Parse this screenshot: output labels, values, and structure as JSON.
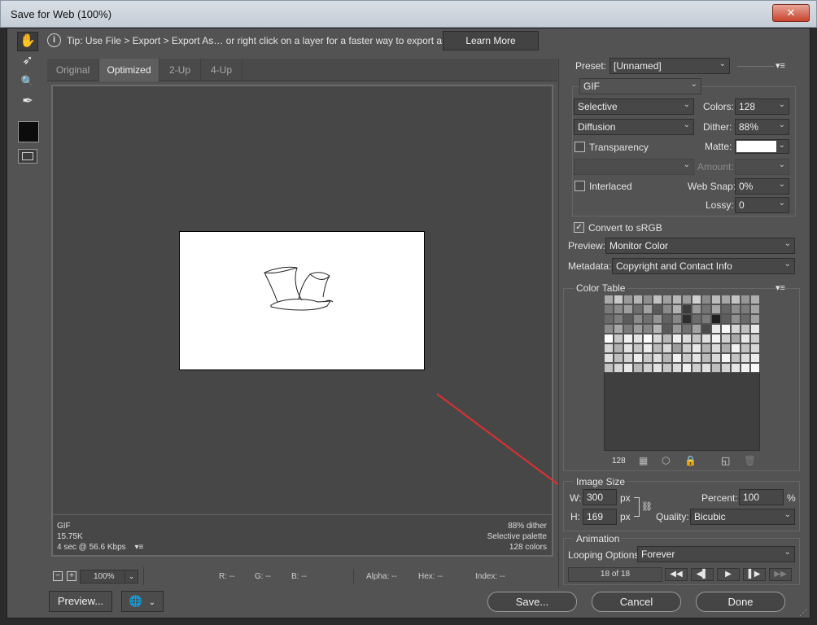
{
  "window": {
    "title": "Save for Web (100%)",
    "close_label": "✕"
  },
  "tools": [
    {
      "name": "hand-tool-icon",
      "glyph": "✋"
    },
    {
      "name": "slice-select-tool-icon",
      "glyph": "➶"
    },
    {
      "name": "zoom-tool-icon",
      "glyph": "🔍"
    },
    {
      "name": "eyedropper-tool-icon",
      "glyph": "✒"
    }
  ],
  "tip": {
    "info_glyph": "i",
    "text": "Tip: Use File > Export > Export As…   or right click on a layer for a faster way to export assets",
    "learn_more": "Learn More"
  },
  "tabs": [
    "Original",
    "Optimized",
    "2-Up",
    "4-Up"
  ],
  "image_info": {
    "format": "GIF",
    "size": "15.75K",
    "download": "4 sec @ 56.6 Kbps",
    "menu_glyph": "▾≡",
    "dither": "88% dither",
    "palette": "Selective palette",
    "colors": "128 colors"
  },
  "status": {
    "zoom": "100%",
    "r": "R: --",
    "g": "G: --",
    "b": "B: --",
    "alpha": "Alpha: --",
    "hex": "Hex: --",
    "index": "Index: --"
  },
  "bottom_buttons": {
    "preview": "Preview...",
    "browser_glyph": "🌐",
    "save": "Save...",
    "cancel": "Cancel",
    "done": "Done"
  },
  "settings": {
    "preset_label": "Preset:",
    "preset_value": "[Unnamed]",
    "format": "GIF",
    "reduction": "Selective",
    "colors_label": "Colors:",
    "colors_value": "128",
    "dither_algo": "Diffusion",
    "dither_label": "Dither:",
    "dither_value": "88%",
    "transparency": "Transparency",
    "matte_label": "Matte:",
    "amount_label": "Amount:",
    "interlaced": "Interlaced",
    "websnap_label": "Web Snap:",
    "websnap_value": "0%",
    "lossy_label": "Lossy:",
    "lossy_value": "0",
    "convert_srgb": "Convert to sRGB",
    "preview_label": "Preview:",
    "preview_value": "Monitor Color",
    "metadata_label": "Metadata:",
    "metadata_value": "Copyright and Contact Info"
  },
  "color_table": {
    "title": "Color Table",
    "count": "128",
    "swatches": [
      "#aaaaaa",
      "#c8c8c8",
      "#9a9a9a",
      "#b5b5b5",
      "#8e8e8e",
      "#c0c0c0",
      "#a0a0a0",
      "#b8b8b8",
      "#9c9c9c",
      "#d0d0d0",
      "#8a8a8a",
      "#bcbcbc",
      "#a6a6a6",
      "#c4c4c4",
      "#969696",
      "#b0b0b0",
      "#7a7a7a",
      "#8c8c8c",
      "#9e9e9e",
      "#6e6e6e",
      "#a2a2a2",
      "#5a5a5a",
      "#8a8a8a",
      "#b2b2b2",
      "#3c3c3c",
      "#9a9a9a",
      "#747474",
      "#a8a8a8",
      "#666666",
      "#8e8e8e",
      "#7c7c7c",
      "#a4a4a4",
      "#6a6a6a",
      "#7e7e7e",
      "#5c5c5c",
      "#8a8a8a",
      "#707070",
      "#949494",
      "#626262",
      "#888888",
      "#2e2e2e",
      "#6c6c6c",
      "#7a7a7a",
      "#1e1e1e",
      "#5e5e5e",
      "#909090",
      "#6a6a6a",
      "#a0a0a0",
      "#8c8c8c",
      "#a8a8a8",
      "#7a7a7a",
      "#9c9c9c",
      "#868686",
      "#b4b4b4",
      "#5a5a5a",
      "#989898",
      "#707070",
      "#a2a2a2",
      "#4a4a4a",
      "#eaeaea",
      "#f8f8f8",
      "#d6d6d6",
      "#c0c0c0",
      "#e8e8e8",
      "#ffffff",
      "#c8c8c8",
      "#f0f0f0",
      "#e4e4e4",
      "#ffffff",
      "#d8d8d8",
      "#b8b8b8",
      "#eeeeee",
      "#dcdcdc",
      "#c4c4c4",
      "#e0e0e0",
      "#f4f4f4",
      "#d0d0d0",
      "#a8a8a8",
      "#e6e6e6",
      "#cccccc",
      "#d4d4d4",
      "#b0b0b0",
      "#e2e2e2",
      "#c6c6c6",
      "#ececec",
      "#bababa",
      "#d8d8d8",
      "#9e9e9e",
      "#cecece",
      "#e8e8e8",
      "#b4b4b4",
      "#dadada",
      "#aeaeae",
      "#f2f2f2",
      "#c2c2c2",
      "#d6d6d6",
      "#e0e0e0",
      "#bebebe",
      "#d2d2d2",
      "#ececec",
      "#c8c8c8",
      "#dedede",
      "#b6b6b6",
      "#f0f0f0",
      "#cacaca",
      "#e4e4e4",
      "#bcbcbc",
      "#d8d8d8",
      "#f6f6f6",
      "#c4c4c4",
      "#dcdcdc",
      "#ebebeb",
      "#c2c2c2",
      "#d6d6d6",
      "#e8e8e8",
      "#b8b8b8",
      "#d0d0d0",
      "#e2e2e2",
      "#c6c6c6",
      "#dadada",
      "#eeeeee",
      "#cecece",
      "#e0e0e0",
      "#bdbdbd",
      "#d4d4d4",
      "#e6e6e6",
      "#f2f2f2",
      "#fafafa"
    ]
  },
  "image_size": {
    "title": "Image Size",
    "w_label": "W:",
    "w_value": "300",
    "h_label": "H:",
    "h_value": "169",
    "unit": "px",
    "percent_label": "Percent:",
    "percent_value": "100",
    "percent_unit": "%",
    "quality_label": "Quality:",
    "quality_value": "Bicubic"
  },
  "animation": {
    "title": "Animation",
    "looping_label": "Looping Options:",
    "looping_value": "Forever",
    "frame_counter": "18 of 18"
  }
}
